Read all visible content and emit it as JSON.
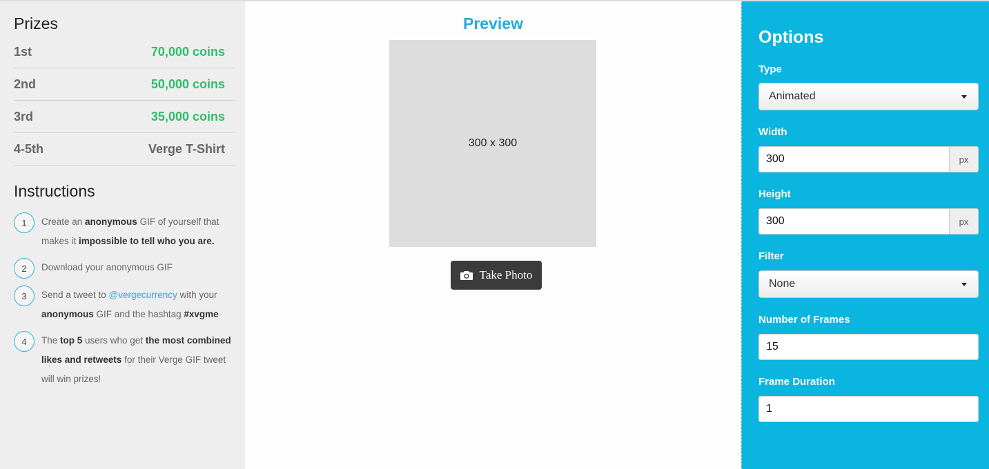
{
  "prizes": {
    "title": "Prizes",
    "rows": [
      {
        "rank": "1st",
        "value": "70,000 coins"
      },
      {
        "rank": "2nd",
        "value": "50,000 coins"
      },
      {
        "rank": "3rd",
        "value": "35,000 coins"
      },
      {
        "rank": "4-5th",
        "value": "Verge T-Shirt"
      }
    ]
  },
  "instructions": {
    "title": "Instructions",
    "steps": [
      {
        "num": "1",
        "parts": [
          {
            "t": "Create an ",
            "s": "n"
          },
          {
            "t": "anonymous",
            "s": "b"
          },
          {
            "t": " GIF of yourself that makes it ",
            "s": "n"
          },
          {
            "t": "impossible to tell who you are.",
            "s": "b"
          }
        ]
      },
      {
        "num": "2",
        "parts": [
          {
            "t": "Download your anonymous GIF",
            "s": "n"
          }
        ]
      },
      {
        "num": "3",
        "parts": [
          {
            "t": "Send a tweet to ",
            "s": "n"
          },
          {
            "t": "@vergecurrency",
            "s": "l"
          },
          {
            "t": " with your ",
            "s": "n"
          },
          {
            "t": "anonymous",
            "s": "b"
          },
          {
            "t": " GIF and the hashtag ",
            "s": "n"
          },
          {
            "t": "#xvgme",
            "s": "b"
          }
        ]
      },
      {
        "num": "4",
        "parts": [
          {
            "t": "The ",
            "s": "n"
          },
          {
            "t": "top 5",
            "s": "b"
          },
          {
            "t": " users who get ",
            "s": "n"
          },
          {
            "t": "the most combined likes and retweets",
            "s": "b"
          },
          {
            "t": " for their Verge GIF tweet will win prizes!",
            "s": "n"
          }
        ]
      }
    ]
  },
  "preview": {
    "title": "Preview",
    "placeholder": "300 x 300",
    "take_photo_label": "Take Photo",
    "camera_icon": "camera-icon"
  },
  "options": {
    "title": "Options",
    "type": {
      "label": "Type",
      "value": "Animated"
    },
    "width": {
      "label": "Width",
      "value": "300",
      "unit": "px"
    },
    "height": {
      "label": "Height",
      "value": "300",
      "unit": "px"
    },
    "filter": {
      "label": "Filter",
      "value": "None"
    },
    "frames": {
      "label": "Number of Frames",
      "value": "15"
    },
    "duration": {
      "label": "Frame Duration",
      "value": "1"
    }
  },
  "colors": {
    "accent": "#0ab5e0",
    "coins": "#2ebf6a",
    "preview_title": "#25abdb"
  }
}
